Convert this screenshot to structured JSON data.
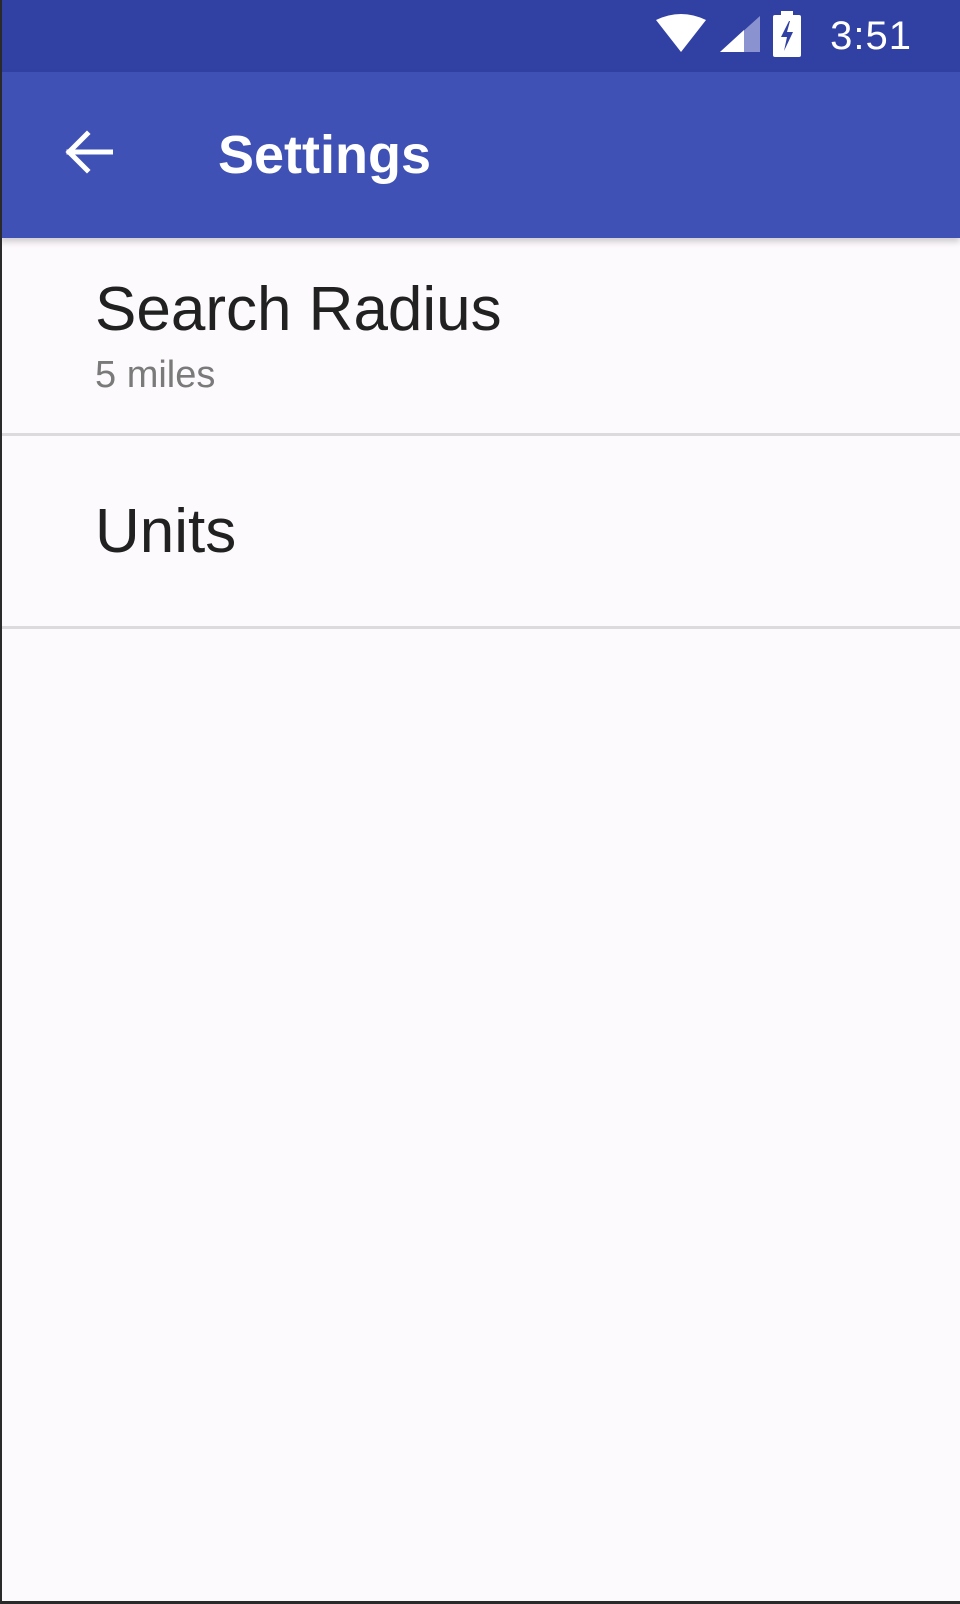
{
  "status_bar": {
    "time": "3:51",
    "icons": [
      "wifi-icon",
      "cellular-signal-icon",
      "battery-charging-icon"
    ],
    "background_color": "#3140a3"
  },
  "app_bar": {
    "title": "Settings",
    "back_icon": "arrow-back-icon",
    "background_color": "#4051b5"
  },
  "preferences": [
    {
      "title": "Search Radius",
      "summary": "5 miles"
    },
    {
      "title": "Units"
    }
  ]
}
